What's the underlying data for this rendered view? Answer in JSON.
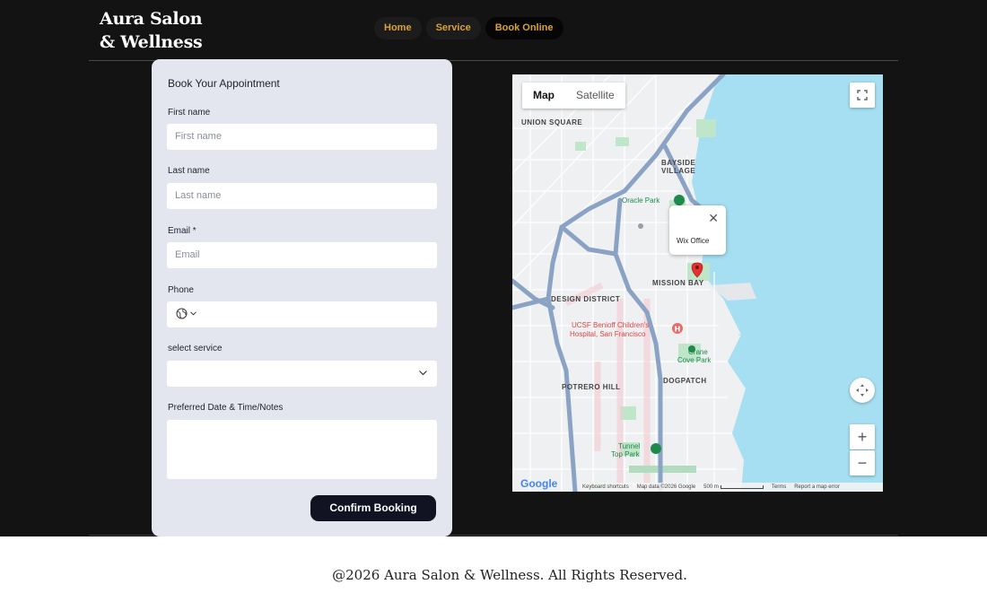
{
  "brand": {
    "line1": "Aura Salon",
    "line2": "& Wellness"
  },
  "nav": {
    "items": [
      {
        "label": "Home"
      },
      {
        "label": "Service"
      },
      {
        "label": "Book Online"
      }
    ],
    "active": "Book Online"
  },
  "form": {
    "title": "Book Your Appointment",
    "first_name": {
      "label": "First name",
      "placeholder": "First name"
    },
    "last_name": {
      "label": "Last name",
      "placeholder": "Last name"
    },
    "email": {
      "label": "Email *",
      "placeholder": "Email"
    },
    "phone": {
      "label": "Phone"
    },
    "service": {
      "label": "select service",
      "value": ""
    },
    "notes": {
      "label": "Preferred Date & Time/Notes",
      "value": ""
    },
    "submit": "Confirm Booking"
  },
  "map": {
    "tabs": [
      "Map",
      "Satellite"
    ],
    "active_tab": "Map",
    "popup_label": "Wix Office",
    "labels": {
      "union_square": "UNION SQUARE",
      "bayside": "BAYSIDE",
      "village": "VILLAGE",
      "oracle_park": "Oracle Park",
      "design_district": "DESIGN DISTRICT",
      "mission_bay": "MISSION BAY",
      "ucsf1": "UCSF Benioff Children's",
      "ucsf2": "Hospital, San Francisco",
      "crane1": "Crane",
      "crane2": "Cove Park",
      "potrero": "POTRERO HILL",
      "dogpatch": "DOGPATCH",
      "tunnel1": "Tunnel",
      "tunnel2": "Top Park"
    },
    "footer": {
      "shortcuts": "Keyboard shortcuts",
      "data": "Map data ©2026 Google",
      "scale": "500 m",
      "terms": "Terms",
      "report": "Report a map error"
    },
    "google": "Google",
    "colors": {
      "water": "#a5dff1",
      "park": "#bfe6c8",
      "highway": "#8aa3c4",
      "pin": "#e4312f"
    }
  },
  "footer": {
    "text": "@2026 Aura Salon & Wellness. All Rights Reserved."
  },
  "colors": {
    "accent": "#d8a23c",
    "card": "#e3e5ef",
    "button": "#111322"
  }
}
